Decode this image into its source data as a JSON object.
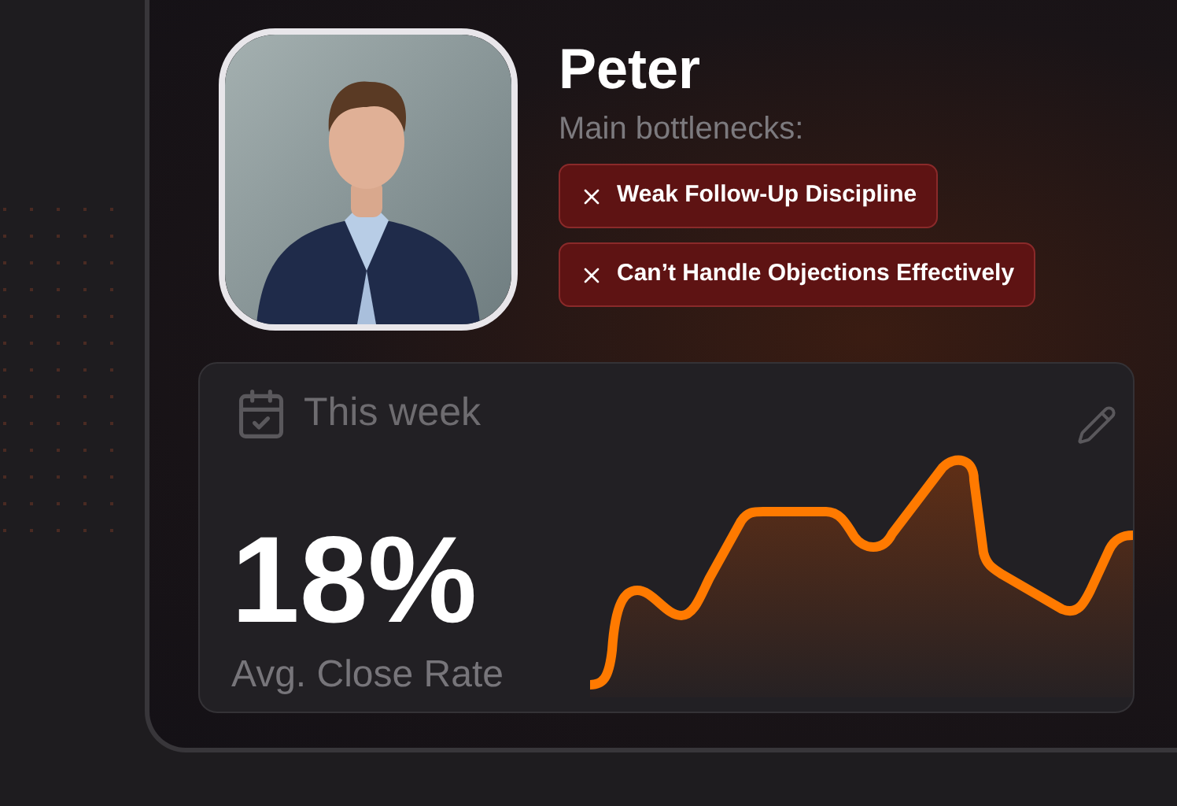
{
  "profile": {
    "name": "Peter",
    "subtitle": "Main bottlenecks:",
    "bottlenecks": [
      "Weak Follow-Up Discipline",
      "Can’t Handle Objections Effectively"
    ]
  },
  "stats_card": {
    "period": "This week",
    "value": "18%",
    "label": "Avg. Close Rate"
  }
}
